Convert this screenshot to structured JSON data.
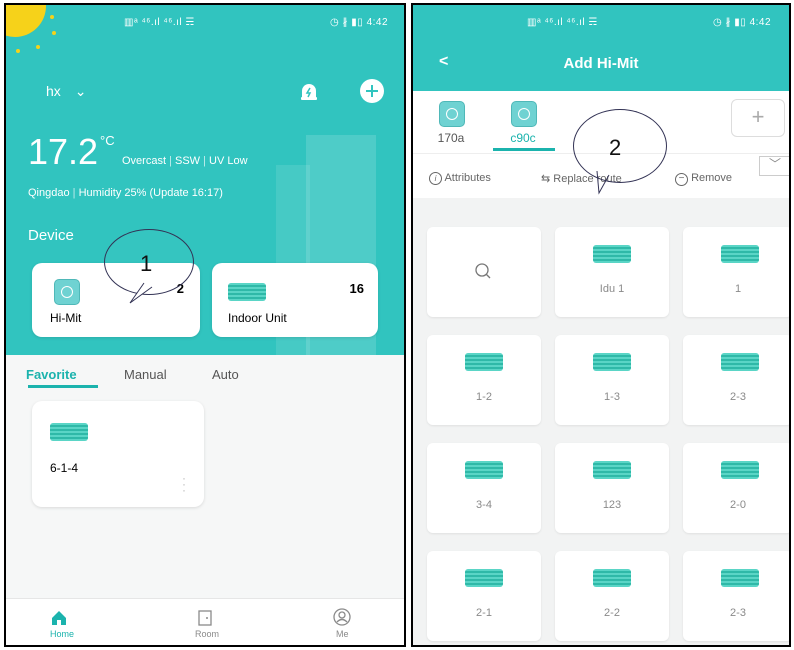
{
  "left": {
    "status_bar": {
      "left": "▥ᵃ ⁴⁶.ıl ⁴⁶.ıl ☴",
      "right": "◷ ∦ ▮▯ 4:42"
    },
    "home_name": "hx",
    "weather": {
      "temp": "17.2",
      "unit": "°C",
      "condition": "Overcast",
      "wind": "SSW",
      "uv": "UV Low",
      "location": "Qingdao",
      "humidity": "Humidity 25%",
      "update": "(Update 16:17)"
    },
    "section_title": "Device",
    "devices": [
      {
        "name": "Hi-Mit",
        "count": "2"
      },
      {
        "name": "Indoor Unit",
        "count": "16"
      }
    ],
    "callout": "1",
    "scene_tabs": [
      "Favorite",
      "Manual",
      "Auto"
    ],
    "favorite_card": {
      "name": "6-1-4"
    },
    "bottom_nav": [
      "Home",
      "Room",
      "Me"
    ]
  },
  "right": {
    "status_bar": {
      "left": "▥ᵃ ⁴⁶.ıl ⁴⁶.ıl ☴",
      "right": "◷ ∦ ▮▯ 4:42"
    },
    "title": "Add Hi-Mit",
    "back": "<",
    "gateways": [
      "170a",
      "c90c"
    ],
    "add": "+",
    "callout": "2",
    "actions": [
      "Attributes",
      "Replace route",
      "Remove"
    ],
    "tiles": [
      "Idu 1",
      "1",
      "1-2",
      "1-3",
      "2-3",
      "3-4",
      "123",
      "2-0",
      "2-1",
      "2-2",
      "2-3"
    ]
  },
  "colors": {
    "teal": "#31c4bf",
    "accent": "#1bb3ad",
    "sun": "#f6d21a"
  }
}
